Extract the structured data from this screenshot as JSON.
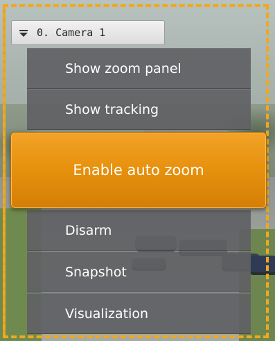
{
  "camera": {
    "title": "0. Camera 1",
    "dropdown_icon": "dropdown-arrow-icon"
  },
  "menu": {
    "items": [
      {
        "label": "Show zoom panel"
      },
      {
        "label": "Show tracking"
      },
      {
        "label": "Enable auto zoom",
        "highlighted": true
      },
      {
        "label": "Disarm"
      },
      {
        "label": "Snapshot"
      },
      {
        "label": "Visualization"
      }
    ]
  },
  "colors": {
    "highlight": "#e8920f",
    "selection_border": "#f0a81e",
    "menu_bg": "#5f6164"
  }
}
